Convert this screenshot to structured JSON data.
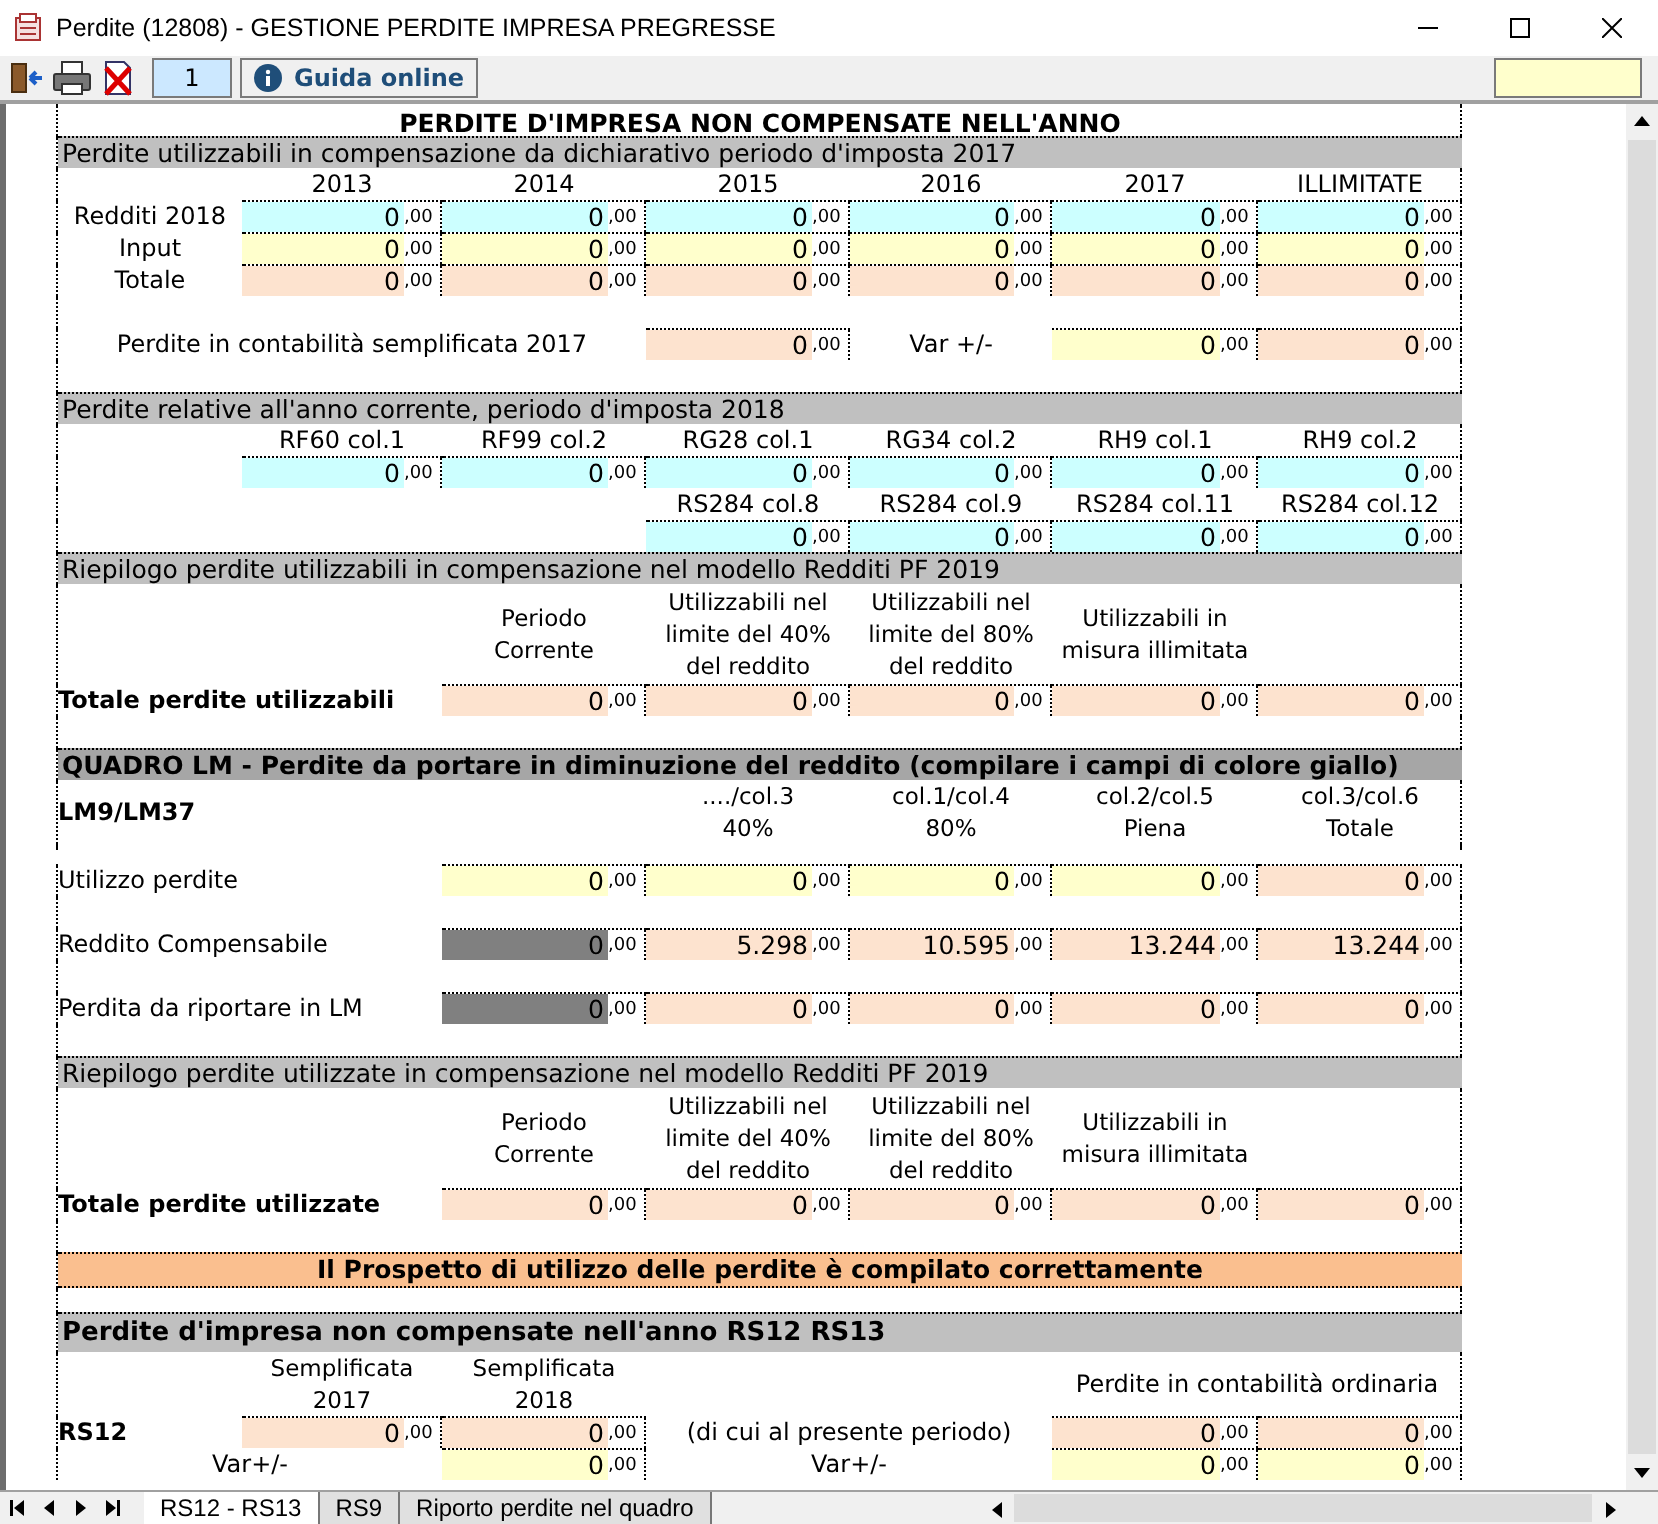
{
  "window": {
    "title": "Perdite (12808) - GESTIONE PERDITE IMPRESA PREGRESSE"
  },
  "toolbar": {
    "page_number": "1",
    "help_button": "Guida online"
  },
  "sheet": {
    "title": "PERDITE D'IMPRESA NON COMPENSATE NELL'ANNO",
    "blocks": [
      {
        "kind": "year-table",
        "header": "Perdite utilizzabili in compensazione da dichiarativo periodo d'imposta 2017",
        "columns": [
          "2013",
          "2014",
          "2015",
          "2016",
          "2017",
          "ILLIMITATE"
        ],
        "rows": [
          {
            "label": "Redditi 2018",
            "amounts": [
              {
                "value": "0",
                "decimals": ",00",
                "kind": "imported"
              },
              {
                "value": "0",
                "decimals": ",00",
                "kind": "imported"
              },
              {
                "value": "0",
                "decimals": ",00",
                "kind": "imported"
              },
              {
                "value": "0",
                "decimals": ",00",
                "kind": "imported"
              },
              {
                "value": "0",
                "decimals": ",00",
                "kind": "imported"
              },
              {
                "value": "0",
                "decimals": ",00",
                "kind": "imported"
              }
            ]
          },
          {
            "label": "Input",
            "amounts": [
              {
                "value": "0",
                "decimals": ",00",
                "kind": "input"
              },
              {
                "value": "0",
                "decimals": ",00",
                "kind": "input"
              },
              {
                "value": "0",
                "decimals": ",00",
                "kind": "input"
              },
              {
                "value": "0",
                "decimals": ",00",
                "kind": "input"
              },
              {
                "value": "0",
                "decimals": ",00",
                "kind": "input"
              },
              {
                "value": "0",
                "decimals": ",00",
                "kind": "input"
              }
            ]
          },
          {
            "label": "Totale",
            "amounts": [
              {
                "value": "0",
                "decimals": ",00",
                "kind": "computed"
              },
              {
                "value": "0",
                "decimals": ",00",
                "kind": "computed"
              },
              {
                "value": "0",
                "decimals": ",00",
                "kind": "computed"
              },
              {
                "value": "0",
                "decimals": ",00",
                "kind": "computed"
              },
              {
                "value": "0",
                "decimals": ",00",
                "kind": "computed"
              },
              {
                "value": "0",
                "decimals": ",00",
                "kind": "computed"
              }
            ]
          }
        ]
      },
      {
        "kind": "semplificata-row",
        "label": "Perdite in contabilità semplificata 2017",
        "amount": {
          "value": "0",
          "decimals": ",00",
          "kind": "computed"
        },
        "var_label": "Var +/-",
        "var_amounts": [
          {
            "value": "0",
            "decimals": ",00",
            "kind": "input"
          },
          {
            "value": "0",
            "decimals": ",00",
            "kind": "computed"
          }
        ]
      },
      {
        "kind": "code-table",
        "header": "Perdite relative all'anno corrente, periodo d'imposta  2018",
        "groups": [
          [
            {
              "code": "RF60 col.1",
              "amount": {
                "value": "0",
                "decimals": ",00",
                "kind": "imported"
              }
            },
            {
              "code": "RF99 col.2",
              "amount": {
                "value": "0",
                "decimals": ",00",
                "kind": "imported"
              }
            },
            {
              "code": "RG28 col.1",
              "amount": {
                "value": "0",
                "decimals": ",00",
                "kind": "imported"
              }
            },
            {
              "code": "RG34 col.2",
              "amount": {
                "value": "0",
                "decimals": ",00",
                "kind": "imported"
              }
            },
            {
              "code": "RH9 col.1",
              "amount": {
                "value": "0",
                "decimals": ",00",
                "kind": "imported"
              }
            },
            {
              "code": "RH9 col.2",
              "amount": {
                "value": "0",
                "decimals": ",00",
                "kind": "imported"
              }
            }
          ],
          [
            {
              "code": "RS284 col.8",
              "amount": {
                "value": "0",
                "decimals": ",00",
                "kind": "imported"
              }
            },
            {
              "code": "RS284 col.9",
              "amount": {
                "value": "0",
                "decimals": ",00",
                "kind": "imported"
              }
            },
            {
              "code": "RS284 col.11",
              "amount": {
                "value": "0",
                "decimals": ",00",
                "kind": "imported"
              }
            },
            {
              "code": "RS284 col.12",
              "amount": {
                "value": "0",
                "decimals": ",00",
                "kind": "imported"
              }
            }
          ]
        ]
      },
      {
        "kind": "summary",
        "header": "Riepilogo perdite utilizzabili in compensazione nel modello Redditi PF 2019",
        "columns": [
          "Periodo\nCorrente",
          "Utilizzabili nel\nlimite del 40%\ndel reddito",
          "Utilizzabili nel\nlimite del 80%\ndel reddito",
          "Utilizzabili in\nmisura illimitata"
        ],
        "total_label": "Totale perdite utilizzabili",
        "amounts": [
          {
            "value": "0",
            "decimals": ",00",
            "kind": "computed"
          },
          {
            "value": "0",
            "decimals": ",00",
            "kind": "computed"
          },
          {
            "value": "0",
            "decimals": ",00",
            "kind": "computed"
          },
          {
            "value": "0",
            "decimals": ",00",
            "kind": "computed"
          },
          {
            "value": "0",
            "decimals": ",00",
            "kind": "computed"
          }
        ]
      },
      {
        "kind": "lm-table",
        "header": "QUADRO LM - Perdite da portare in diminuzione del reddito (compilare i campi di colore giallo)",
        "code": "LM9/LM37",
        "columns": [
          "..../col.3\n40%",
          "col.1/col.4\n80%",
          "col.2/col.5\nPiena",
          "col.3/col.6\nTotale"
        ],
        "rows": [
          {
            "label": "Utilizzo perdite",
            "amounts": [
              {
                "value": "0",
                "decimals": ",00",
                "kind": "input"
              },
              {
                "value": "0",
                "decimals": ",00",
                "kind": "input"
              },
              {
                "value": "0",
                "decimals": ",00",
                "kind": "input"
              },
              {
                "value": "0",
                "decimals": ",00",
                "kind": "input"
              },
              {
                "value": "0",
                "decimals": ",00",
                "kind": "computed"
              }
            ]
          },
          {
            "label": "Reddito Compensabile",
            "amounts": [
              {
                "value": "0",
                "decimals": ",00",
                "kind": "locked"
              },
              {
                "value": "5.298",
                "decimals": ",00",
                "kind": "computed"
              },
              {
                "value": "10.595",
                "decimals": ",00",
                "kind": "computed"
              },
              {
                "value": "13.244",
                "decimals": ",00",
                "kind": "computed"
              },
              {
                "value": "13.244",
                "decimals": ",00",
                "kind": "computed"
              }
            ]
          },
          {
            "label": "Perdita da riportare in LM",
            "amounts": [
              {
                "value": "0",
                "decimals": ",00",
                "kind": "locked"
              },
              {
                "value": "0",
                "decimals": ",00",
                "kind": "computed"
              },
              {
                "value": "0",
                "decimals": ",00",
                "kind": "computed"
              },
              {
                "value": "0",
                "decimals": ",00",
                "kind": "computed"
              },
              {
                "value": "0",
                "decimals": ",00",
                "kind": "computed"
              }
            ]
          }
        ]
      },
      {
        "kind": "summary",
        "header": "Riepilogo perdite utilizzate in compensazione nel modello Redditi PF 2019",
        "columns": [
          "Periodo\nCorrente",
          "Utilizzabili nel\nlimite del 40%\ndel reddito",
          "Utilizzabili nel\nlimite del 80%\ndel reddito",
          "Utilizzabili in\nmisura illimitata"
        ],
        "total_label": "Totale perdite utilizzate",
        "amounts": [
          {
            "value": "0",
            "decimals": ",00",
            "kind": "computed"
          },
          {
            "value": "0",
            "decimals": ",00",
            "kind": "computed"
          },
          {
            "value": "0",
            "decimals": ",00",
            "kind": "computed"
          },
          {
            "value": "0",
            "decimals": ",00",
            "kind": "computed"
          },
          {
            "value": "0",
            "decimals": ",00",
            "kind": "computed"
          }
        ]
      },
      {
        "kind": "banner",
        "text": "Il Prospetto di utilizzo delle perdite è compilato correttamente"
      },
      {
        "kind": "rs12-table",
        "header": "Perdite d'impresa non compensate nell'anno RS12 RS13",
        "columns": [
          "Semplificata\n2017",
          "Semplificata\n2018"
        ],
        "ordinary_header": "Perdite in contabilità ordinaria",
        "rows": [
          {
            "kind": "code",
            "label": "RS12",
            "amounts": [
              {
                "value": "0",
                "decimals": ",00",
                "kind": "computed"
              },
              {
                "value": "0",
                "decimals": ",00",
                "kind": "computed"
              }
            ],
            "note": "(di cui al presente periodo)",
            "ordinary_amounts": [
              {
                "value": "0",
                "decimals": ",00",
                "kind": "computed"
              },
              {
                "value": "0",
                "decimals": ",00",
                "kind": "computed"
              }
            ]
          },
          {
            "kind": "variation",
            "label": "Var+/-",
            "amounts": [
              {
                "value": "0",
                "decimals": ",00",
                "kind": "input"
              }
            ],
            "note": "Var+/-",
            "ordinary_amounts": [
              {
                "value": "0",
                "decimals": ",00",
                "kind": "input"
              },
              {
                "value": "0",
                "decimals": ",00",
                "kind": "input"
              }
            ]
          }
        ]
      }
    ]
  },
  "sheet_tabs": [
    {
      "label": "RS12 - RS13",
      "selected": true
    },
    {
      "label": "RS9",
      "selected": false
    },
    {
      "label": "Riporto perdite nel quadro",
      "selected": false
    }
  ]
}
